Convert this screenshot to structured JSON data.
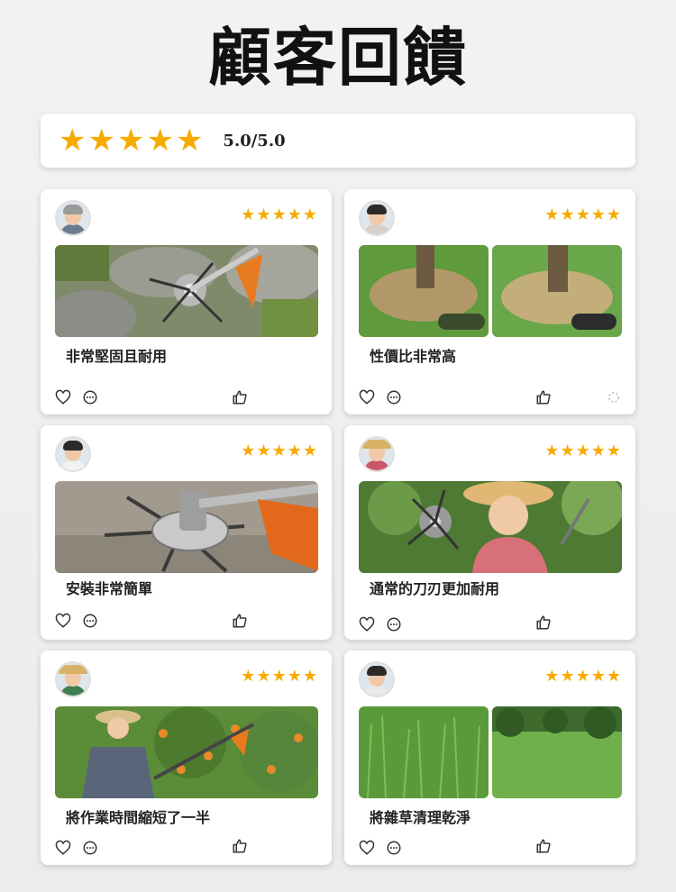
{
  "title": "顧客回饋",
  "summary": {
    "score": "5.0/5.0",
    "stars": 5
  },
  "reviews": [
    {
      "text": "非常堅固且耐用",
      "stars": "★★★★★"
    },
    {
      "text": "性價比非常高",
      "stars": "★★★★★"
    },
    {
      "text": "安裝非常簡單",
      "stars": "★★★★★"
    },
    {
      "text": "通常的刀刃更加耐用",
      "stars": "★★★★★"
    },
    {
      "text": "將作業時間縮短了一半",
      "stars": "★★★★★"
    },
    {
      "text": "將雜草清理乾淨",
      "stars": "★★★★★"
    }
  ],
  "icons": [
    "heart-icon",
    "comment-icon",
    "thumbs-up-icon"
  ],
  "colors": {
    "star": "#f6ab00",
    "background": "#efefef",
    "card": "#ffffff"
  }
}
